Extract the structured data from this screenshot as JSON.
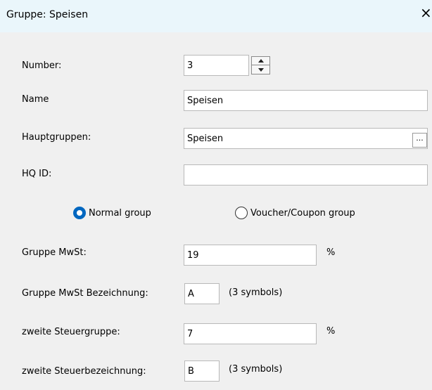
{
  "window": {
    "title": "Gruppe: Speisen",
    "close_glyph": "×"
  },
  "fields": {
    "number": {
      "label": "Number:",
      "value": "3"
    },
    "name": {
      "label": "Name",
      "value": "Speisen"
    },
    "hauptgruppen": {
      "label": "Hauptgruppen:",
      "value": "Speisen",
      "browse_label": "..."
    },
    "hq_id": {
      "label": "HQ ID:",
      "value": ""
    },
    "gruppe_mwst": {
      "label": "Gruppe MwSt:",
      "value": "19",
      "unit": "%"
    },
    "gruppe_mwst_bez": {
      "label": "Gruppe MwSt Bezeichnung:",
      "value": "A",
      "hint": "(3 symbols)"
    },
    "zweite_steuergruppe": {
      "label": "zweite Steuergruppe:",
      "value": "7",
      "unit": "%"
    },
    "zweite_steuerbez": {
      "label": "zweite Steuerbezeichnung:",
      "value": "B",
      "hint": "(3 symbols)"
    }
  },
  "group_type": {
    "options": [
      {
        "label": "Normal group",
        "selected": true
      },
      {
        "label": "Voucher/Coupon group",
        "selected": false
      }
    ]
  },
  "colors": {
    "titlebar_bg": "#eaf6fb",
    "window_bg": "#f0f0f0",
    "radio_accent": "#0067c0"
  },
  "icons": {
    "close": "close-icon",
    "spin_up": "chevron-up-icon",
    "spin_down": "chevron-down-icon",
    "browse": "ellipsis-icon"
  }
}
